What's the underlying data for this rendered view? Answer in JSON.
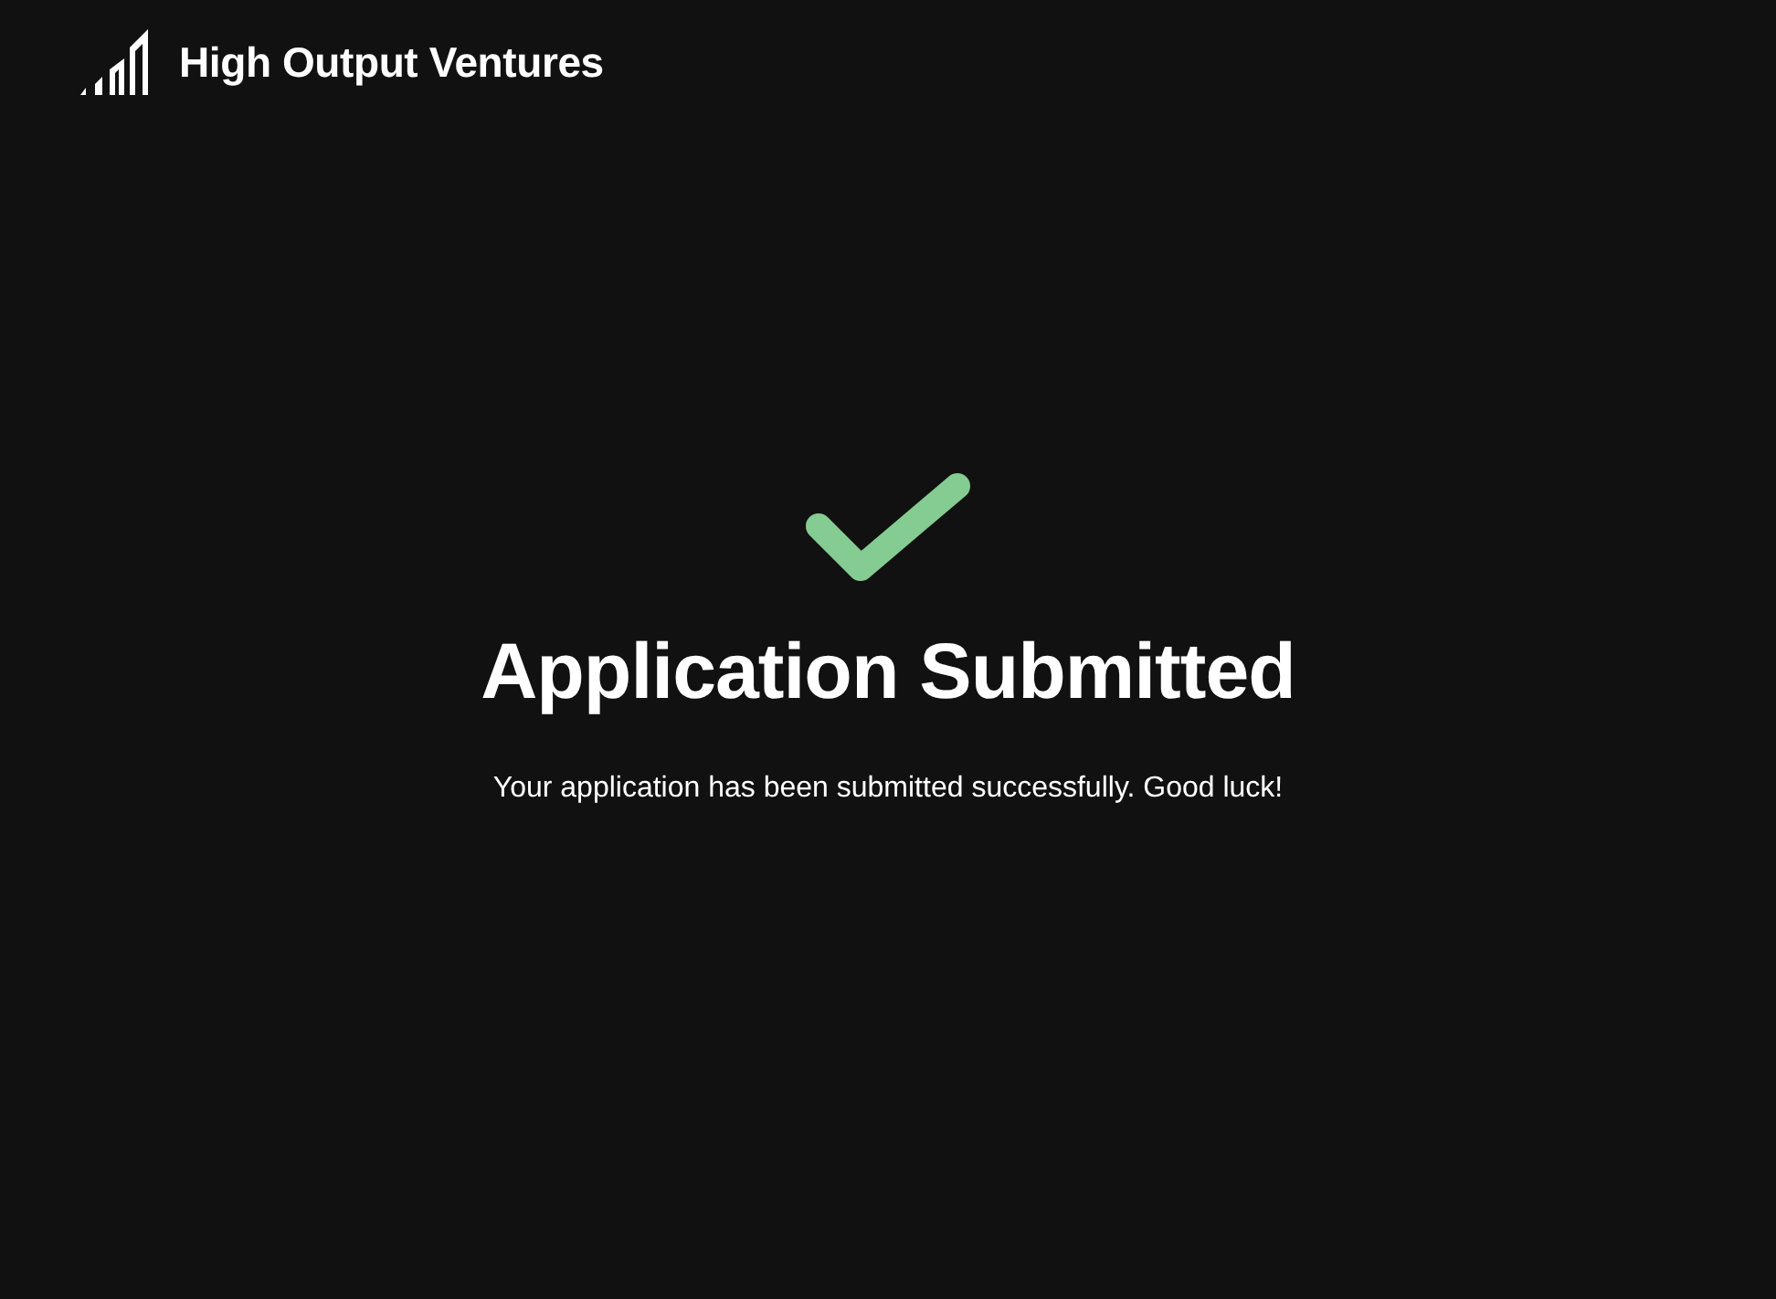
{
  "header": {
    "brand": "High Output Ventures"
  },
  "confirmation": {
    "succeeded": true,
    "title": "Application Submitted",
    "message": "Your application has been submitted successfully. Good luck!"
  }
}
